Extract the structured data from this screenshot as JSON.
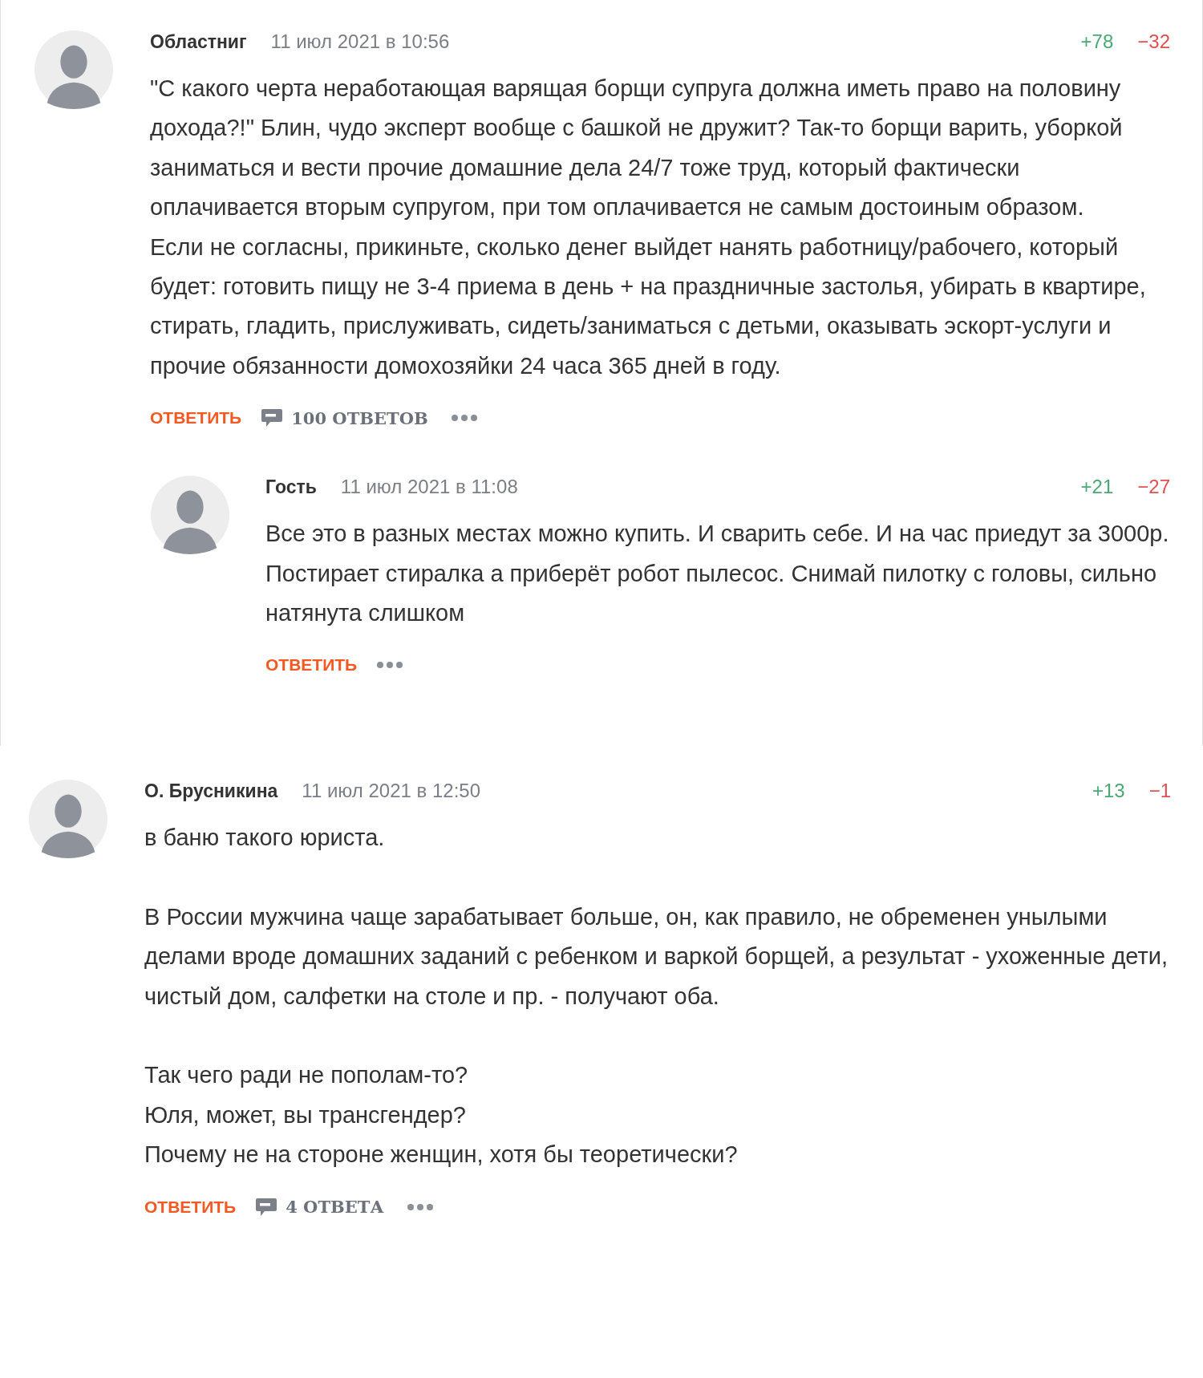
{
  "threads": [
    {
      "author": "Областниг",
      "date": "11 июл 2021 в 10:56",
      "plus": "+78",
      "minus": "−32",
      "paragraphs": [
        [
          "\"С какого черта неработающая варящая борщи супруга должна иметь право на половину дохода?!\" Блин, чудо эксперт вообще с башкой не дружит? Так-то борщи варить, уборкой заниматься и вести прочие домашние дела 24/7 тоже труд, который фактически оплачивается вторым супругом, при том оплачивается не самым достоиным образом.",
          "Если не согласны, прикиньте, сколько денег выйдет нанять работницу/рабочего, который будет: готовить пищу не 3-4 приема в день + на праздничные застолья, убирать в квартире, стирать, гладить, прислуживать, сидеть/заниматься с детьми, оказывать эскорт-услуги и прочие обязанности домохозяйки 24 часа 365 дней в году."
        ]
      ],
      "reply_label": "ОТВЕТИТЬ",
      "replies_count": "100 ОТВЕТОВ",
      "children": [
        {
          "author": "Гость",
          "date": "11 июл 2021 в 11:08",
          "plus": "+21",
          "minus": "−27",
          "paragraphs": [
            [
              "Все это в разных местах можно купить. И сварить себе. И на час приедут за 3000р. Постирает стиралка а приберёт робот пылесос. Снимай пилотку с головы, сильно натянута слишком"
            ]
          ],
          "reply_label": "ОТВЕТИТЬ"
        }
      ]
    },
    {
      "author": "О. Брусникина",
      "date": "11 июл 2021 в 12:50",
      "plus": "+13",
      "minus": "−1",
      "paragraphs": [
        [
          "в баню такого юриста."
        ],
        [
          "В России мужчина чаще зарабатывает больше, он, как правило, не обременен унылыми делами вроде домашних заданий с ребенком и варкой борщей, а результат - ухоженные дети, чистый дом, салфетки на столе и пр. - получают оба."
        ],
        [
          "Так чего ради не пополам-то?",
          "Юля, может, вы трансгендер?",
          "Почему не на стороне женщин, хотя бы теоретически?"
        ]
      ],
      "reply_label": "ОТВЕТИТЬ",
      "replies_count": "4 ОТВЕТА"
    }
  ]
}
